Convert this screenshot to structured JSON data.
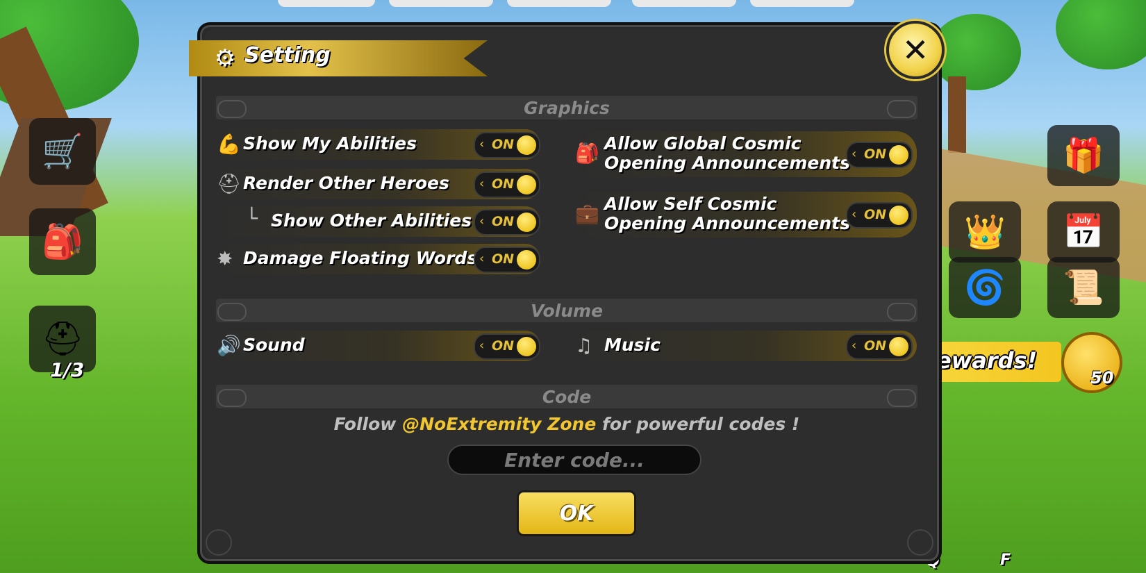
{
  "panel": {
    "title": "Setting",
    "sections": {
      "graphics": "Graphics",
      "volume": "Volume",
      "code": "Code"
    }
  },
  "graphics_left": [
    {
      "label": "Show My Abilities",
      "icon": "muscle-arm-icon",
      "state": "ON"
    },
    {
      "label": "Render Other Heroes",
      "icon": "helmet-icon",
      "state": "ON"
    },
    {
      "label": "Show Other Abilities",
      "icon": "sub-item-corner",
      "state": "ON"
    },
    {
      "label": "Damage Floating Words",
      "icon": "damage-burst-icon",
      "state": "ON"
    }
  ],
  "graphics_right": [
    {
      "label_line1": "Allow Global Cosmic",
      "label_line2": "Opening Announcements",
      "icon": "backpack-icon",
      "state": "ON"
    },
    {
      "label_line1": "Allow Self Cosmic",
      "label_line2": "Opening Announcements",
      "icon": "briefcase-icon",
      "state": "ON"
    }
  ],
  "volume": [
    {
      "label": "Sound",
      "icon": "speaker-icon",
      "state": "ON"
    },
    {
      "label": "Music",
      "icon": "music-note-icon",
      "state": "ON"
    }
  ],
  "code": {
    "hint_prefix": "Follow ",
    "hint_highlight": "@NoExtremity Zone",
    "hint_suffix": " for powerful codes !",
    "placeholder": "Enter code...",
    "ok_label": "OK"
  },
  "hud": {
    "hero_count": "1/3",
    "rewards_label": "ewards!",
    "coin_count": "50",
    "key_q": "Q",
    "key_f": "F"
  },
  "colors": {
    "accent_gold": "#e6c13a",
    "panel_bg": "#2d2d2d",
    "highlight_text": "#f1c630"
  }
}
